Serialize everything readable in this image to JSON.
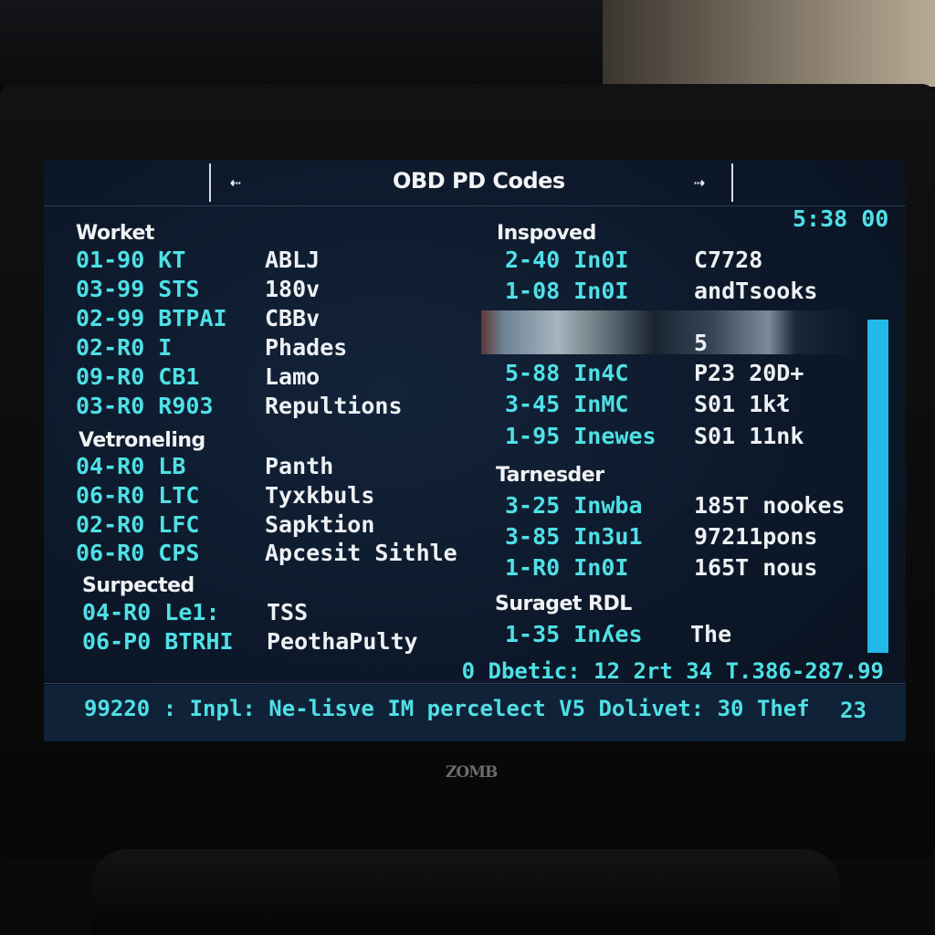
{
  "header": {
    "title": "OBD PD Codes",
    "back_icon": "arrow-left-icon",
    "forward_icon": "arrow-right-icon"
  },
  "clock": "5:38 00",
  "left": {
    "sections": [
      {
        "title": "Worket",
        "rows": [
          {
            "code": "01-90 KT",
            "desc": "ABLJ"
          },
          {
            "code": "03-99 STS",
            "desc": "180v"
          },
          {
            "code": "02-99 BTPAI",
            "desc": "CBBv"
          },
          {
            "code": "02-R0 I",
            "desc": "Phades"
          },
          {
            "code": "09-R0 CB1",
            "desc": "Lamo"
          },
          {
            "code": "03-R0 R903",
            "desc": "Repultions"
          }
        ]
      },
      {
        "title": "Vetroneling",
        "rows": [
          {
            "code": "04-R0 LB",
            "desc": "Panth"
          },
          {
            "code": "06-R0 LTC",
            "desc": "Tyxkbuls"
          },
          {
            "code": "02-R0 LFC",
            "desc": "Sapktion"
          },
          {
            "code": "06-R0 CPS",
            "desc": "Apcesit Sithle"
          }
        ]
      },
      {
        "title": "Surpected",
        "rows": [
          {
            "code": "04-R0 Le1:",
            "desc": "TSS"
          },
          {
            "code": "06-P0 BTRHI",
            "desc": "PeothaPulty"
          }
        ]
      }
    ]
  },
  "right": {
    "sections": [
      {
        "title": "Inspoved",
        "rows": [
          {
            "code": "2-40 In0I",
            "desc": "C7728"
          },
          {
            "code": "1-08 In0I",
            "desc": "andTsooks"
          },
          {
            "code": "",
            "desc": "5"
          },
          {
            "code": "5-88 In4C",
            "desc": "P23 20D+"
          },
          {
            "code": "3-45 InMC",
            "desc": "S01 1kł"
          },
          {
            "code": "1-95 Inewes",
            "desc": "S01 11nk"
          }
        ]
      },
      {
        "title": "Tarnesder",
        "rows": [
          {
            "code": "3-25 Inwba",
            "desc": "185T nookes"
          },
          {
            "code": "3-85 In3u1",
            "desc": "97211pons"
          },
          {
            "code": "1-R0 In0I",
            "desc": "165T nous"
          }
        ]
      },
      {
        "title": "Suraget RDL",
        "rows": [
          {
            "code": "1-35 Inʎes",
            "desc": "The"
          }
        ]
      }
    ]
  },
  "summary": "0 Dbetic: 12 2rt 34 T.386-287.99",
  "status_bar": {
    "left": "99220 : Inpl: Ne-lisve IM percelect V5 Dolivet: 30 Thef",
    "right": "23"
  },
  "monitor_brand": "ZOMB",
  "colors": {
    "code": "#4fe0e6",
    "scrollbar": "#22b8e8",
    "screen_bg": "#0b1626"
  }
}
